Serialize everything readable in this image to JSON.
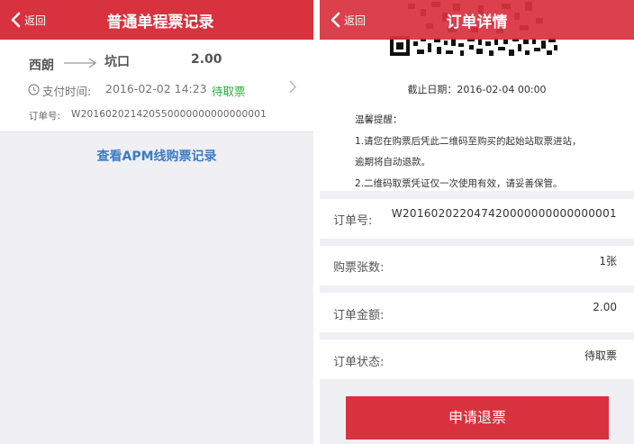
{
  "left": {
    "header": {
      "back_label": "返回",
      "title": "普通单程票记录"
    },
    "record": {
      "from_station": "西朗",
      "to_station": "坑口",
      "amount": "2.00",
      "pay_time_label": "支付时间:",
      "pay_time": "2016-02-02 14:23",
      "status": "待取票",
      "order_no_label": "订单号:",
      "order_no": "W201602021420550000000000000001"
    },
    "apm_link": "查看APM线购票记录"
  },
  "right": {
    "header": {
      "back_label": "返回",
      "title": "订单详情"
    },
    "deadline": "截止日期：2016-02-04 00:00",
    "tips": {
      "title": "温馨提醒：",
      "line1": "1.请您在购票后凭此二维码至购买的起始站取票进站，",
      "line2": "逾期将自动退款。",
      "line3": "2.二维码取票凭证仅一次使用有效，请妥善保管。"
    },
    "rows": [
      {
        "label": "订单号:",
        "value": "W201602022047420000000000000001"
      },
      {
        "label": "购票张数:",
        "value": "1张"
      },
      {
        "label": "订单金额:",
        "value": "2.00"
      },
      {
        "label": "订单状态:",
        "value": "待取票"
      }
    ],
    "refund_button": "申请退票"
  },
  "colors": {
    "primary_red": "#d8323e",
    "status_green": "#27b034",
    "link_blue": "#3b7bc7"
  },
  "icons": [
    "back-chevron-icon",
    "arrow-right-icon",
    "clock-icon",
    "chevron-right-icon",
    "qr-code-icon"
  ]
}
